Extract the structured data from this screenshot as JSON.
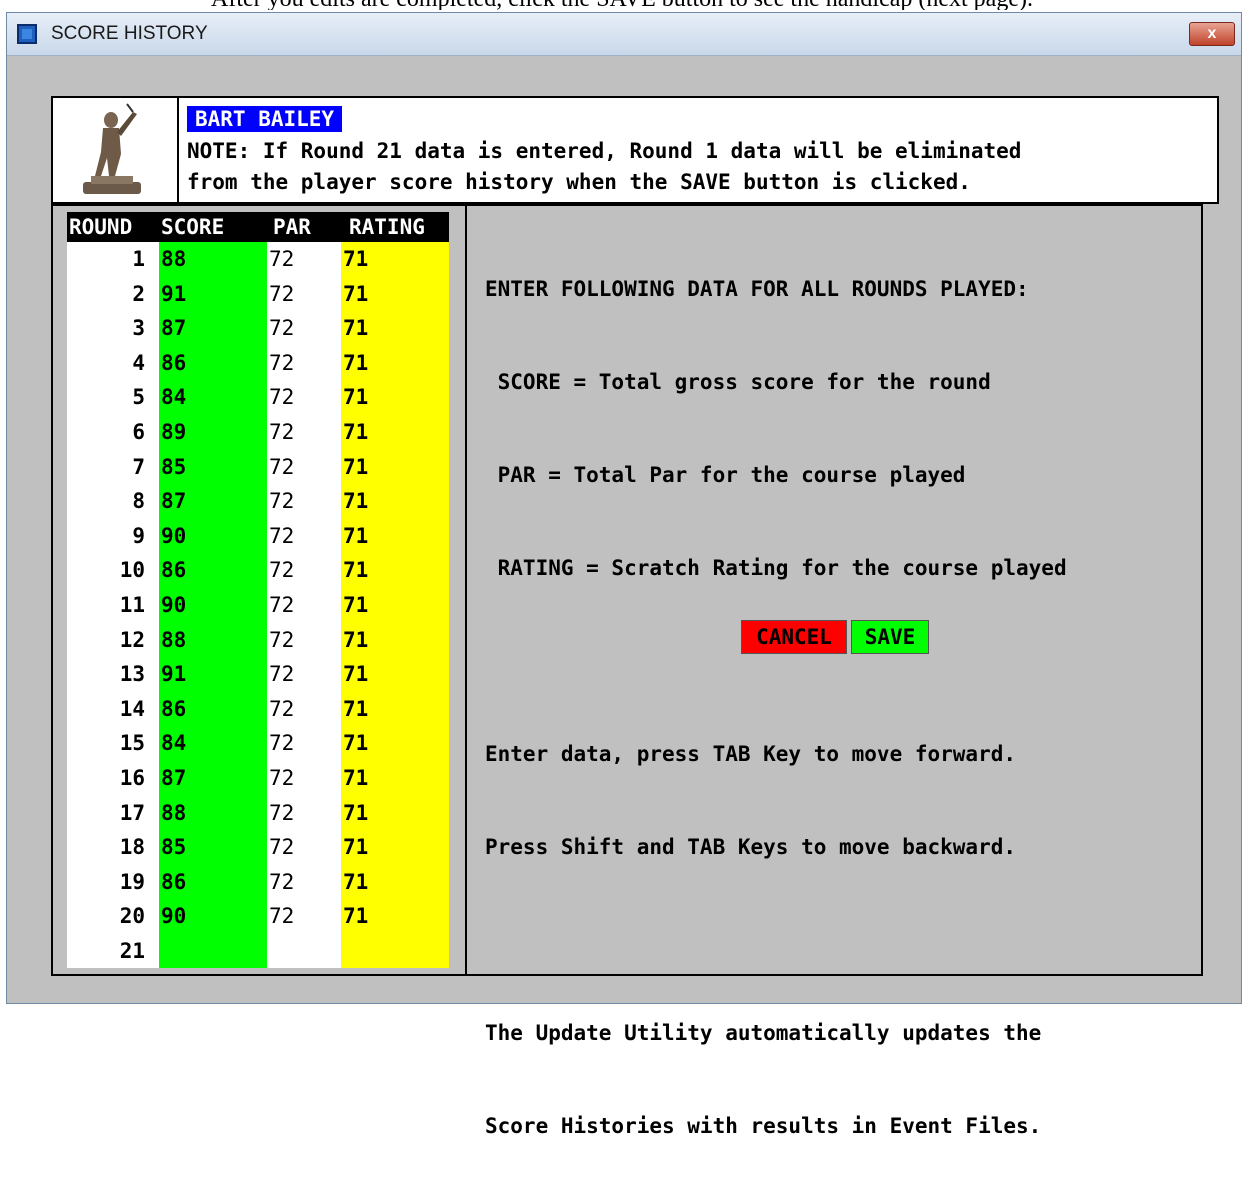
{
  "page_top_text": "After you edits are completed, click the SAVE button to see the handicap (next page).",
  "window": {
    "title": "SCORE HISTORY",
    "close_label": "x",
    "icon": "app-window-icon"
  },
  "player": {
    "name": "BART BAILEY",
    "note_line1": "NOTE: If Round 21 data is entered, Round 1 data will be eliminated",
    "note_line2": "from the player score history when the SAVE button is clicked.",
    "image": "golfer-trophy-image"
  },
  "table": {
    "headers": {
      "round": "ROUND",
      "score": "SCORE",
      "par": "PAR",
      "rating": "RATING"
    },
    "rows": [
      {
        "round": "1",
        "score": "88",
        "par": "72",
        "rating": "71"
      },
      {
        "round": "2",
        "score": "91",
        "par": "72",
        "rating": "71"
      },
      {
        "round": "3",
        "score": "87",
        "par": "72",
        "rating": "71"
      },
      {
        "round": "4",
        "score": "86",
        "par": "72",
        "rating": "71"
      },
      {
        "round": "5",
        "score": "84",
        "par": "72",
        "rating": "71"
      },
      {
        "round": "6",
        "score": "89",
        "par": "72",
        "rating": "71"
      },
      {
        "round": "7",
        "score": "85",
        "par": "72",
        "rating": "71"
      },
      {
        "round": "8",
        "score": "87",
        "par": "72",
        "rating": "71"
      },
      {
        "round": "9",
        "score": "90",
        "par": "72",
        "rating": "71"
      },
      {
        "round": "10",
        "score": "86",
        "par": "72",
        "rating": "71"
      },
      {
        "round": "11",
        "score": "90",
        "par": "72",
        "rating": "71"
      },
      {
        "round": "12",
        "score": "88",
        "par": "72",
        "rating": "71"
      },
      {
        "round": "13",
        "score": "91",
        "par": "72",
        "rating": "71"
      },
      {
        "round": "14",
        "score": "86",
        "par": "72",
        "rating": "71"
      },
      {
        "round": "15",
        "score": "84",
        "par": "72",
        "rating": "71"
      },
      {
        "round": "16",
        "score": "87",
        "par": "72",
        "rating": "71"
      },
      {
        "round": "17",
        "score": "88",
        "par": "72",
        "rating": "71"
      },
      {
        "round": "18",
        "score": "85",
        "par": "72",
        "rating": "71"
      },
      {
        "round": "19",
        "score": "86",
        "par": "72",
        "rating": "71"
      },
      {
        "round": "20",
        "score": "90",
        "par": "72",
        "rating": "71"
      },
      {
        "round": "21",
        "score": "",
        "par": "",
        "rating": ""
      }
    ],
    "colors": {
      "score_bg": "#00ff00",
      "par_bg": "#ffffff",
      "rating_bg": "#ffff00",
      "header_bg": "#000000"
    }
  },
  "instructions": {
    "line1": "ENTER FOLLOWING DATA FOR ALL ROUNDS PLAYED:",
    "line2": " SCORE = Total gross score for the round",
    "line3": " PAR = Total Par for the course played",
    "line4": " RATING = Scratch Rating for the course played",
    "line5": "Enter data, press TAB Key to move forward.",
    "line6": "Press Shift and TAB Keys to move backward.",
    "line7": "The Update Utility automatically updates the",
    "line8": "Score Histories with results in Event Files."
  },
  "buttons": {
    "cancel_label": "CANCEL",
    "save_label": "SAVE",
    "cancel_color": "#ff0000",
    "save_color": "#00ff00"
  }
}
